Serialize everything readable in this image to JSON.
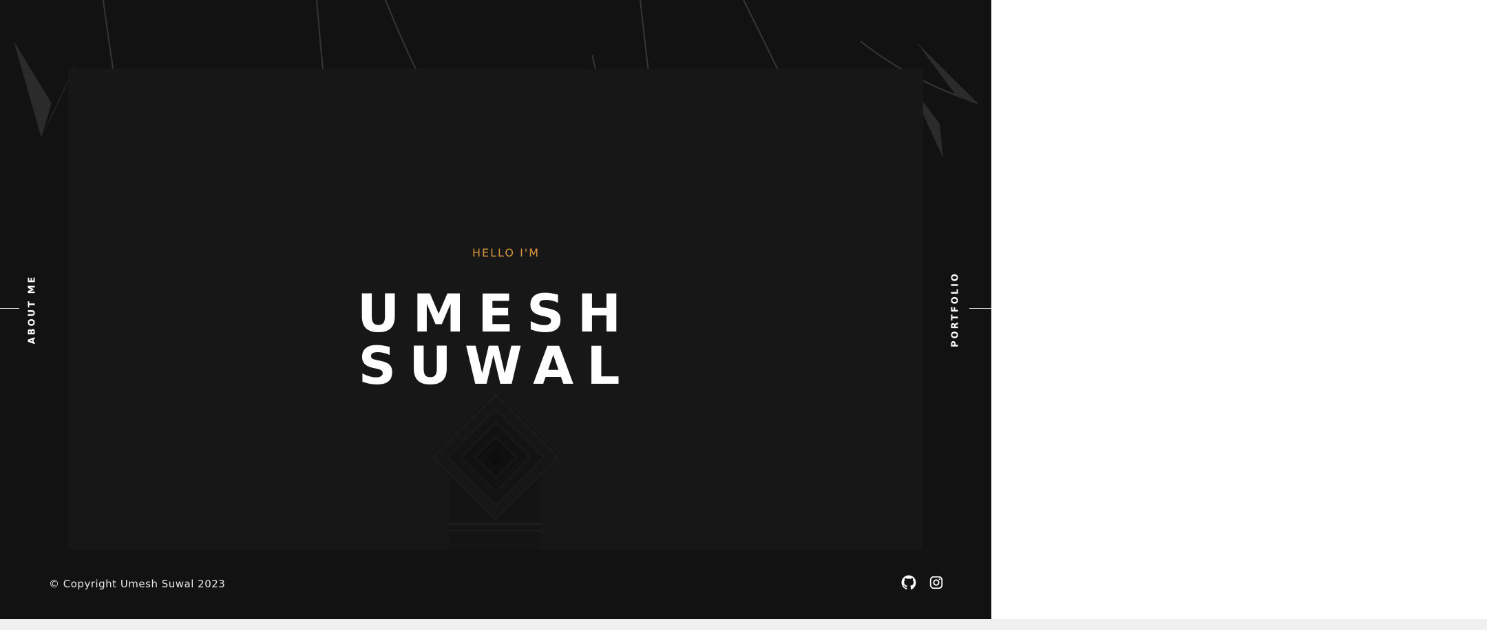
{
  "hero": {
    "eyebrow": "HELLO I'M",
    "title": "UMESH SUWAL"
  },
  "nav": {
    "left_label": "ABOUT ME",
    "right_label": "PORTFOLIO"
  },
  "footer": {
    "copyright": "© Copyright Umesh Suwal 2023",
    "social": [
      {
        "icon": "github-icon"
      },
      {
        "icon": "instagram-icon"
      }
    ]
  },
  "colors": {
    "background": "#121212",
    "panel": "#171717",
    "accent": "#d9963d",
    "text": "#ffffff"
  }
}
